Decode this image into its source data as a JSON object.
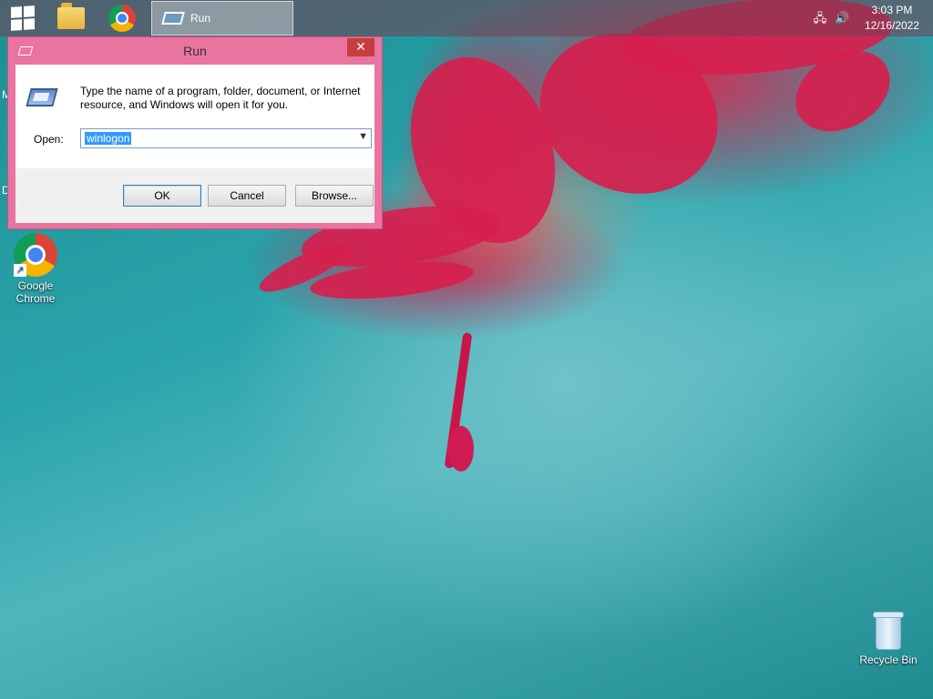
{
  "taskbar": {
    "running_app_label": "Run",
    "clock": {
      "time": "3:03 PM",
      "date": "12/16/2022"
    }
  },
  "desktop": {
    "icons": [
      {
        "label_line1": "Google",
        "label_line2": "Chrome"
      },
      {
        "label_line1": "Recycle Bin"
      }
    ],
    "edge_letters": [
      "M",
      "D"
    ]
  },
  "run_dialog": {
    "title": "Run",
    "description": "Type the name of a program, folder, document, or Internet resource, and Windows will open it for you.",
    "open_label": "Open:",
    "open_value": "winlogon",
    "ok_label": "OK",
    "cancel_label": "Cancel",
    "browse_label": "Browse...",
    "close_glyph": "✕"
  },
  "colors": {
    "dialog_frame": "#e8749f",
    "desktop_teal": "#2aa4ab",
    "flower_red": "#d6204e"
  }
}
